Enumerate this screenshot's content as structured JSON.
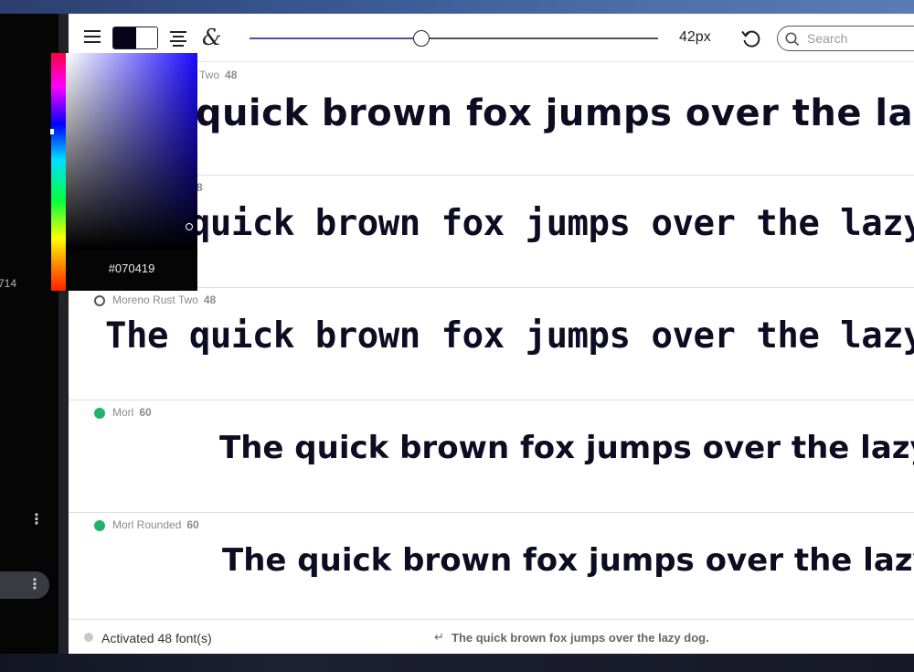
{
  "sidebar": {
    "count_text": "714"
  },
  "toolbar": {
    "fg_color": "#070419",
    "bg_color": "#ffffff",
    "size_value": 42,
    "size_max": 100,
    "size_label": "42px",
    "search_placeholder": "Search",
    "glyph": "&"
  },
  "picker": {
    "hex": "#070419"
  },
  "rows": [
    {
      "name": "Moreno Rust Two",
      "name_visible": "Two",
      "size": "48",
      "sample": "The quick brown fox jumps over the lazy dog.",
      "status": "hidden"
    },
    {
      "name_visible": "",
      "size": "8",
      "sample": "The quick brown fox jumps over the lazy dog.",
      "status": "hidden"
    },
    {
      "name": "Moreno Rust Two",
      "size": "48",
      "sample": "The quick brown fox jumps over the lazy dog.",
      "status": "inactive"
    },
    {
      "name": "Morl",
      "size": "60",
      "sample": "The quick brown fox jumps over the lazy dog.",
      "status": "active"
    },
    {
      "name": "Morl Rounded",
      "size": "60",
      "sample": "The quick brown fox jumps over the lazy dog.",
      "status": "active"
    }
  ],
  "status": {
    "text": "Activated 48 font(s)",
    "enter_icon": "↵",
    "preview": "The quick brown fox jumps over the lazy dog."
  }
}
